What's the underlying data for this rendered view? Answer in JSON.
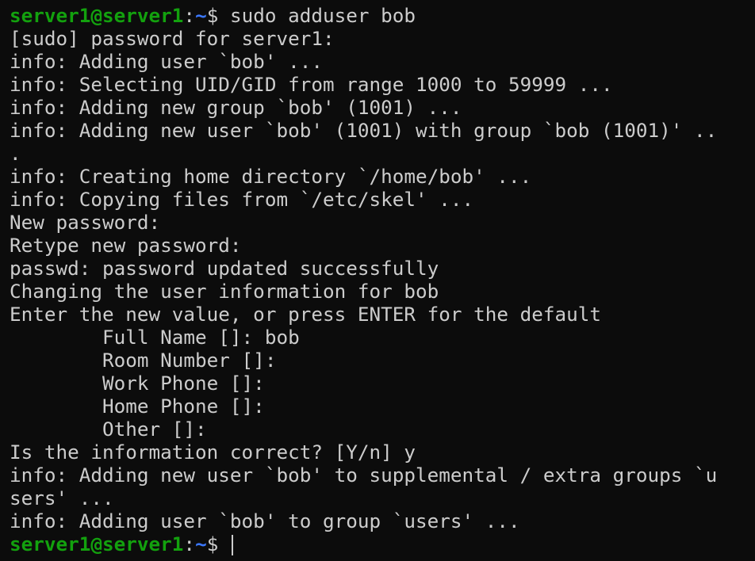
{
  "terminal": {
    "prompt": {
      "user_host": "server1@server1",
      "colon": ":",
      "path": "~",
      "sigil": "$ "
    },
    "command": "sudo adduser bob",
    "output_lines": [
      "[sudo] password for server1:",
      "info: Adding user `bob' ...",
      "info: Selecting UID/GID from range 1000 to 59999 ...",
      "info: Adding new group `bob' (1001) ...",
      "info: Adding new user `bob' (1001) with group `bob (1001)' ..",
      ".",
      "info: Creating home directory `/home/bob' ...",
      "info: Copying files from `/etc/skel' ...",
      "New password:",
      "Retype new password:",
      "passwd: password updated successfully",
      "Changing the user information for bob",
      "Enter the new value, or press ENTER for the default",
      "        Full Name []: bob",
      "        Room Number []:",
      "        Work Phone []:",
      "        Home Phone []:",
      "        Other []:",
      "Is the information correct? [Y/n] y",
      "info: Adding new user `bob' to supplemental / extra groups `u",
      "sers' ...",
      "info: Adding user `bob' to group `users' ..."
    ],
    "colors": {
      "background": "#0c0c0c",
      "text": "#cccccc",
      "prompt_user": "#13a10e",
      "prompt_path": "#3b78ff"
    }
  }
}
